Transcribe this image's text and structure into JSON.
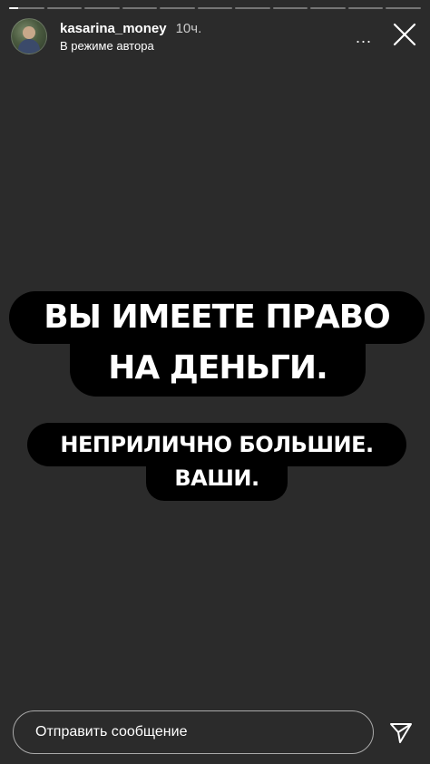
{
  "story": {
    "segment_count": 11,
    "current_segment_progress": 0.25
  },
  "header": {
    "username": "kasarina_money",
    "time_ago": "10ч.",
    "subtitle": "В режиме автора",
    "more_label": "...",
    "avatar_icon": "avatar-photo",
    "close_icon": "close-icon"
  },
  "content": {
    "line1": "ВЫ ИМЕЕТЕ ПРАВО",
    "line2": "НА ДЕНЬГИ.",
    "line3": "НЕПРИЛИЧНО БОЛЬШИЕ.",
    "line4": "ВАШИ."
  },
  "footer": {
    "message_placeholder": "Отправить сообщение",
    "send_icon": "send-icon"
  },
  "colors": {
    "background": "#2b2b2b",
    "bubble": "#000000",
    "text": "#ffffff"
  }
}
